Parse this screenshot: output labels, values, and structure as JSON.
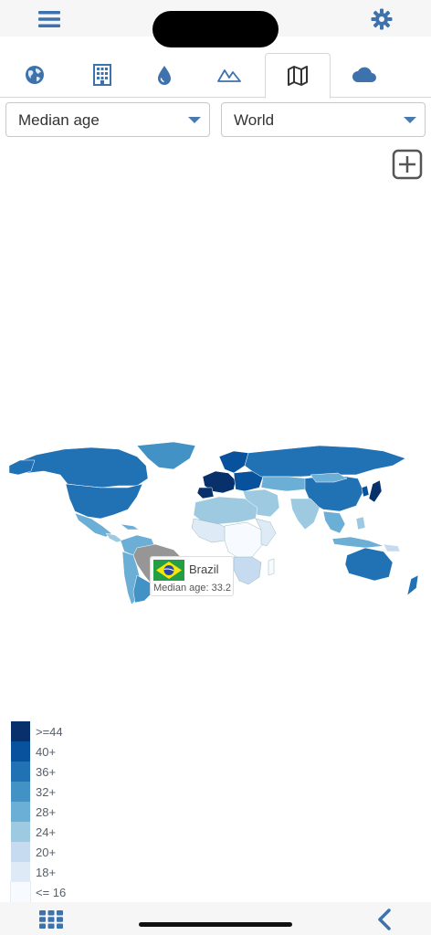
{
  "colors": {
    "accent": "#3d72ad",
    "bar_bg": "#f6f6f6"
  },
  "header": {
    "menu_icon": "hamburger-menu-icon",
    "settings_icon": "gear-icon"
  },
  "tabs": [
    {
      "icon": "globe-icon",
      "active": false
    },
    {
      "icon": "building-icon",
      "active": false
    },
    {
      "icon": "water-drop-icon",
      "active": false
    },
    {
      "icon": "mountains-icon",
      "active": false
    },
    {
      "icon": "map-icon",
      "active": true
    },
    {
      "icon": "cloud-icon",
      "active": false
    }
  ],
  "controls": {
    "indicator": {
      "value": "Median age"
    },
    "region": {
      "value": "World"
    },
    "zoom_icon": "zoom-in-plus-icon"
  },
  "tooltip": {
    "country": "Brazil",
    "label": "Median age: 33.2",
    "flag_icon": "brazil-flag-icon"
  },
  "legend": [
    {
      "label": ">=44",
      "color": "#08306b"
    },
    {
      "label": "40+",
      "color": "#08519c"
    },
    {
      "label": "36+",
      "color": "#2171b5"
    },
    {
      "label": "32+",
      "color": "#4292c6"
    },
    {
      "label": "28+",
      "color": "#6baed6"
    },
    {
      "label": "24+",
      "color": "#9ecae1"
    },
    {
      "label": "20+",
      "color": "#c6dbef"
    },
    {
      "label": "18+",
      "color": "#deebf7"
    },
    {
      "label": "<= 16",
      "color": "#f7fbff"
    }
  ],
  "footer": {
    "grid_icon": "grid-view-icon",
    "back_icon": "chevron-left-icon"
  }
}
